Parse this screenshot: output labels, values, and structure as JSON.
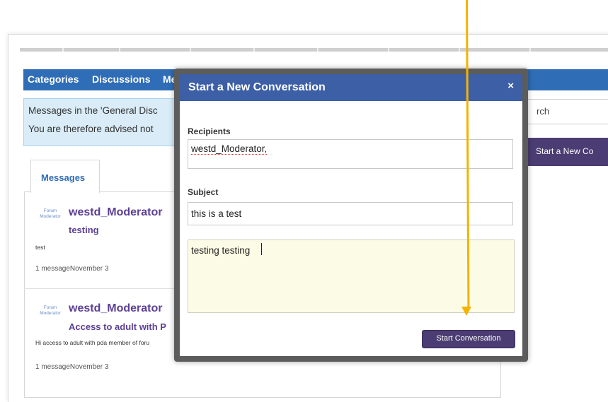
{
  "nav": {
    "categories": "Categories",
    "discussions": "Discussions",
    "messages_partial": "Me"
  },
  "notice": {
    "line1": "Messages in the 'General Disc",
    "line2": "You are therefore advised not"
  },
  "search": {
    "partial": "rch"
  },
  "start_conversation_bg": {
    "label": "Start a New Co"
  },
  "tab": {
    "label": "Messages"
  },
  "messages": [
    {
      "role_line1": "Forum",
      "role_line2": "Moderator",
      "author": "westd_Moderator",
      "subject": "testing",
      "body": "test",
      "meta": "1 messageNovember 3"
    },
    {
      "role_line1": "Forum",
      "role_line2": "Moderator",
      "author": "westd_Moderator",
      "subject": "Access to adult with P",
      "body": "Hi access to adult with pda member of foru",
      "meta": "1 messageNovember 3"
    }
  ],
  "modal": {
    "title": "Start a New Conversation",
    "close": "×",
    "recipients_label": "Recipients",
    "recipients_value": "westd_Moderator,",
    "subject_label": "Subject",
    "subject_value": "this is a test",
    "message_value": "testing testing",
    "submit_label": "Start Conversation"
  },
  "colors": {
    "nav_blue": "#2f6db6",
    "modal_header": "#3d5fa6",
    "purple_button": "#4b3d73",
    "author_purple": "#5b3f93",
    "annotation_arrow": "#f5b301"
  }
}
